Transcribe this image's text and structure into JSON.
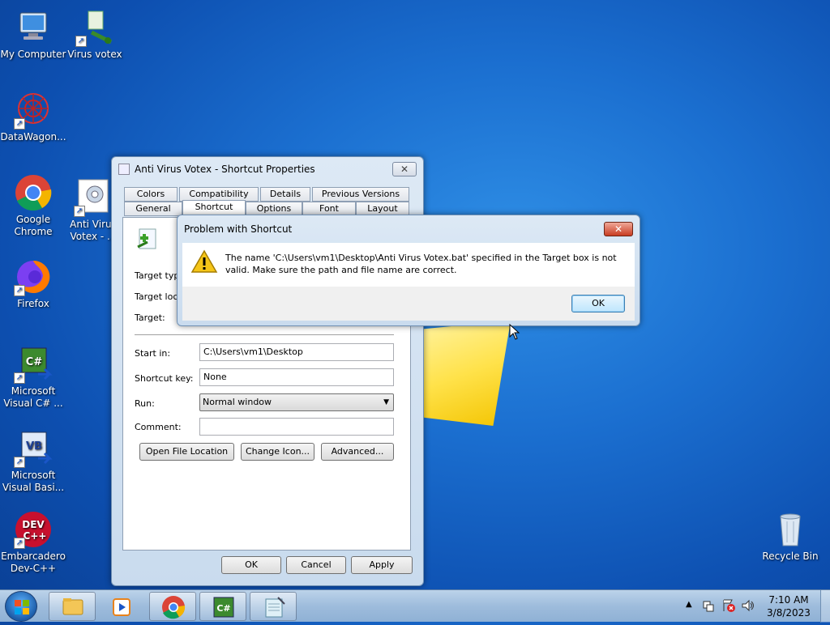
{
  "desktop_icons": [
    {
      "label": "My Computer",
      "icon": "computer-icon"
    },
    {
      "label": "Virus votex",
      "icon": "shortcut-arrow-icon"
    },
    {
      "label": "DataWagon...",
      "icon": "network-icon"
    },
    {
      "label": "Google Chrome",
      "icon": "chrome-icon"
    },
    {
      "label": "Anti Virus Votex - ...",
      "icon": "gear-shortcut-icon"
    },
    {
      "label": "Firefox",
      "icon": "firefox-icon"
    },
    {
      "label": "Microsoft Visual C# ...",
      "icon": "csharp-icon"
    },
    {
      "label": "Microsoft Visual Basi...",
      "icon": "vb-icon"
    },
    {
      "label": "Embarcadero Dev-C++",
      "icon": "devcpp-icon"
    },
    {
      "label": "Recycle Bin",
      "icon": "recycle-bin-icon"
    }
  ],
  "properties": {
    "title": "Anti Virus Votex - Shortcut Properties",
    "close": "✕",
    "tabs_row1": [
      "Colors",
      "Compatibility",
      "Details",
      "Previous Versions"
    ],
    "tabs_row2": [
      "General",
      "Shortcut",
      "Options",
      "Font",
      "Layout"
    ],
    "labels": {
      "target_type": "Target type:",
      "target_location": "Target location:",
      "target": "Target:",
      "start_in": "Start in:",
      "shortcut_key": "Shortcut key:",
      "run": "Run:",
      "comment": "Comment:"
    },
    "start_in_value": "C:\\Users\\vm1\\Desktop",
    "shortcut_key_value": "None",
    "run_value": "Normal window",
    "comment_value": "",
    "buttons": {
      "open_file_location": "Open File Location",
      "change_icon": "Change Icon...",
      "advanced": "Advanced...",
      "ok": "OK",
      "cancel": "Cancel",
      "apply": "Apply"
    }
  },
  "error_dialog": {
    "title": "Problem with Shortcut",
    "close": "✕",
    "message_line1": "The name 'C:\\Users\\vm1\\Desktop\\Anti Virus Votex.bat' specified in the Target box is not",
    "message_line2": "valid. Make sure the path and file name are correct.",
    "ok": "OK"
  },
  "taskbar": {
    "time": "7:10 AM",
    "date": "3/8/2023",
    "show_hidden": "▲"
  },
  "colors": {
    "accent": "#1b6fd0",
    "error_close": "#c83c22"
  }
}
